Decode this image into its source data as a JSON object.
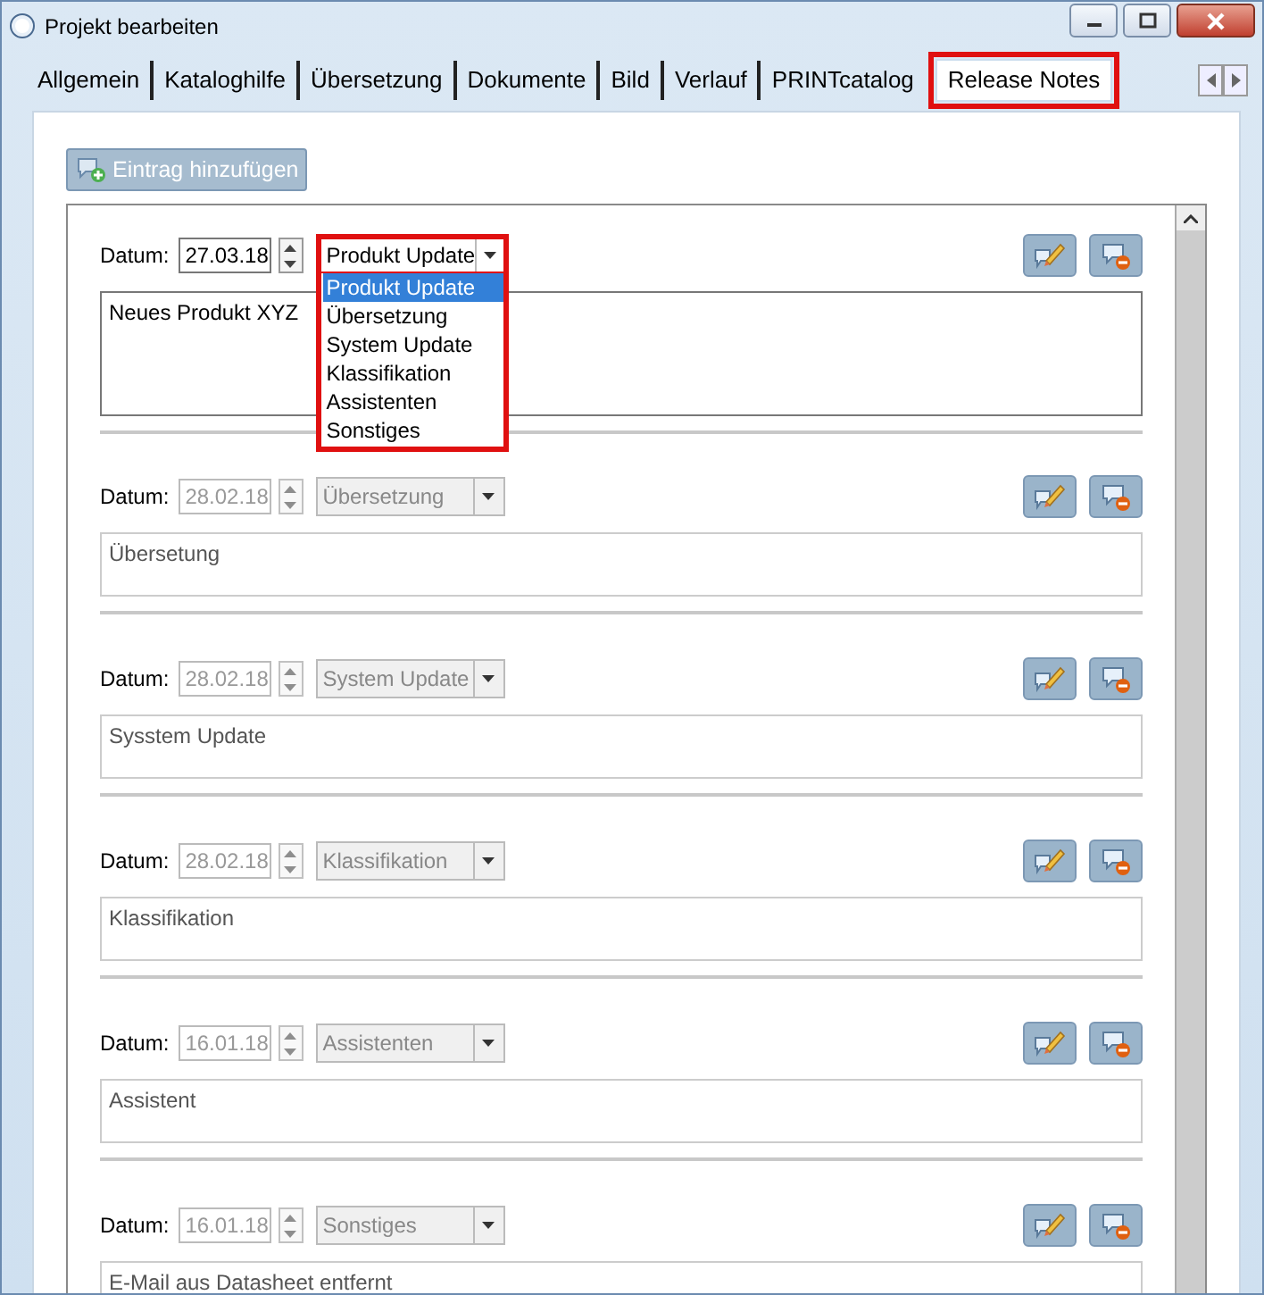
{
  "window": {
    "title": "Projekt bearbeiten"
  },
  "tabs": [
    {
      "label": "Allgemein",
      "selected": false
    },
    {
      "label": "Kataloghilfe",
      "selected": false
    },
    {
      "label": "Übersetzung",
      "selected": false
    },
    {
      "label": "Dokumente",
      "selected": false
    },
    {
      "label": "Bild",
      "selected": false
    },
    {
      "label": "Verlauf",
      "selected": false
    },
    {
      "label": "PRINTcatalog",
      "selected": false
    },
    {
      "label": "Release Notes",
      "selected": true
    }
  ],
  "add_button": {
    "label": "Eintrag hinzufügen",
    "disabled": true
  },
  "entries": [
    {
      "date_label": "Datum:",
      "date": "27.03.18",
      "category": "Produkt Update",
      "text": "Neues Produkt XYZ",
      "disabled": false,
      "expanded": true
    },
    {
      "date_label": "Datum:",
      "date": "28.02.18",
      "category": "Übersetzung",
      "text": "Übersetung",
      "disabled": true,
      "expanded": false
    },
    {
      "date_label": "Datum:",
      "date": "28.02.18",
      "category": "System Update",
      "text": "Sysstem Update",
      "disabled": true,
      "expanded": false
    },
    {
      "date_label": "Datum:",
      "date": "28.02.18",
      "category": "Klassifikation",
      "text": "Klassifikation",
      "disabled": true,
      "expanded": false
    },
    {
      "date_label": "Datum:",
      "date": "16.01.18",
      "category": "Assistenten",
      "text": "Assistent",
      "disabled": true,
      "expanded": false
    },
    {
      "date_label": "Datum:",
      "date": "16.01.18",
      "category": "Sonstiges",
      "text": "E-Mail aus Datasheet entfernt",
      "disabled": true,
      "expanded": false
    }
  ],
  "category_options": [
    {
      "label": "Produkt Update",
      "selected": true
    },
    {
      "label": "Übersetzung",
      "selected": false
    },
    {
      "label": "System Update",
      "selected": false
    },
    {
      "label": "Klassifikation",
      "selected": false
    },
    {
      "label": "Assistenten",
      "selected": false
    },
    {
      "label": "Sonstiges",
      "selected": false
    }
  ]
}
